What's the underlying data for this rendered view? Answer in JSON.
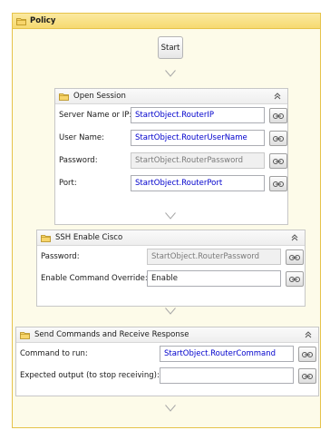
{
  "workflow": {
    "title": "Policy",
    "start_label": "Start"
  },
  "open_session": {
    "title": "Open Session",
    "fields": [
      {
        "label": "Server Name or IP:",
        "value": "StartObject.RouterIP",
        "state": "expression"
      },
      {
        "label": "User Name:",
        "value": "StartObject.RouterUserName",
        "state": "expression"
      },
      {
        "label": "Password:",
        "value": "StartObject.RouterPassword",
        "state": "disabled"
      },
      {
        "label": "Port:",
        "value": "StartObject.RouterPort",
        "state": "expression"
      }
    ]
  },
  "ssh_enable": {
    "title": "SSH Enable Cisco",
    "fields": [
      {
        "label": "Password:",
        "value": "StartObject.RouterPassword",
        "state": "disabled"
      },
      {
        "label": "Enable Command Override:",
        "value": "Enable",
        "state": "literal"
      }
    ]
  },
  "send_commands": {
    "title": "Send Commands and Receive Response",
    "fields": [
      {
        "label": "Command to run:",
        "value": "StartObject.RouterCommand",
        "state": "expression"
      },
      {
        "label": "Expected output (to stop receiving):",
        "value": "",
        "state": "empty"
      }
    ]
  },
  "icons": {
    "folder": "folder-icon",
    "collapse": "collapse-chevron-icon",
    "expression_editor": "expression-editor-icon",
    "flow_arrow": "flow-arrow-down-icon"
  },
  "colors": {
    "outer_border": "#e6c34a",
    "outer_header": "#f6d970",
    "expression_text": "#0000cc",
    "disabled_text": "#7a7a7a"
  }
}
